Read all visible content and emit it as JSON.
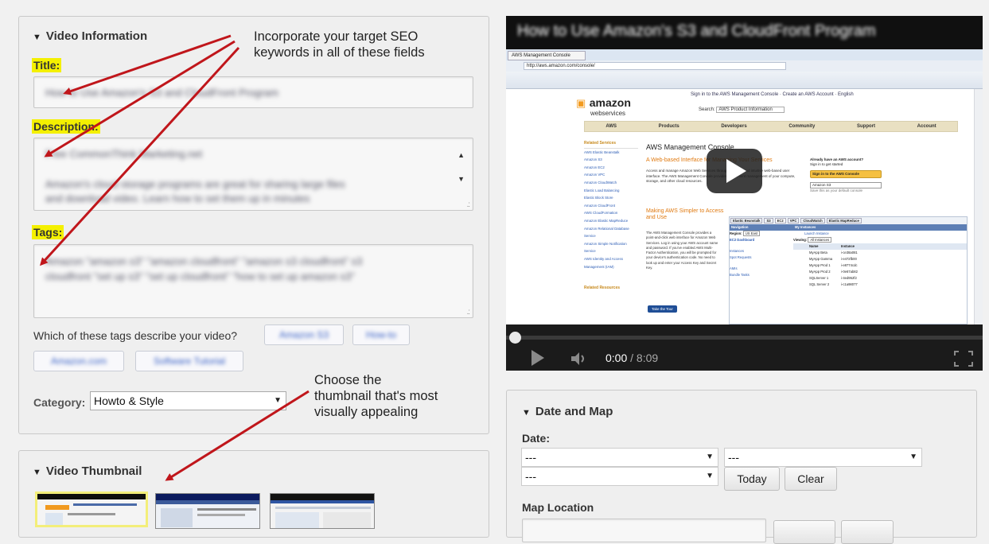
{
  "video_info": {
    "heading": "Video Information",
    "title_label": "Title:",
    "title_value": "How to Use Amazon's S3 and CloudFront Program",
    "description_label": "Description:",
    "description_line1": "Free CommonThink Marketing.net",
    "description_line2": "Amazon's cloud storage programs are great for sharing large files",
    "description_line3": "and download video. Learn how to set them up in minutes",
    "tags_label": "Tags:",
    "tags_line1": "Amazon \"amazon s3\" \"amazon cloudfront\" \"amazon s3 cloudfront\" s3",
    "tags_line2": "cloudfront \"set up s3\" \"set up cloudfront\" \"how to set up amazon s3\"",
    "suggest_question": "Which of these tags describe your video?",
    "suggested_tags": [
      "Amazon S3",
      "How-to",
      "Amazon.com",
      "Software Tutorial"
    ],
    "category_label": "Category:",
    "category_value": "Howto & Style"
  },
  "thumbnail": {
    "heading": "Video Thumbnail"
  },
  "annotations": {
    "seo_line1": "Incorporate your target SEO",
    "seo_line2": "keywords in all of these fields",
    "thumb_line1": "Choose the",
    "thumb_line2": "thumbnail that's most",
    "thumb_line3": "visually appealing"
  },
  "video": {
    "title": "How to Use Amazon's S3 and CloudFront Program",
    "time_current": "0:00",
    "time_total": " / 8:09",
    "progress": 0,
    "browser": {
      "tab": "AWS Management Console",
      "url": "http://aws.amazon.com/console/",
      "brand_line1": "amazon",
      "brand_line2": "webservices",
      "search_label": "Search:",
      "search_value": "AWS Product Information",
      "top_links": [
        "Sign in to the AWS Management Console",
        "Create an AWS Account",
        "English"
      ],
      "nav": [
        "AWS",
        "Products",
        "Developers",
        "Community",
        "Support",
        "Account"
      ],
      "side_heading": "Related Services",
      "side_items": [
        "AWS Elastic Beanstalk",
        "Amazon S3",
        "Amazon EC2",
        "Amazon VPC",
        "Amazon CloudWatch",
        "Elastic Load Balancing",
        "Elastic Block Store",
        "Amazon CloudFront",
        "AWS CloudFormation",
        "Amazon Elastic MapReduce",
        "Amazon Relational Database Service",
        "Amazon Simple Notification Service",
        "AWS Identity and Access Management (IAM)"
      ],
      "side_heading2": "Related Resources",
      "page_heading": "AWS Management Console",
      "subheading": "A Web-based Interface for Managing Your Services",
      "body_text": "Access and manage Amazon Web Services through a simple and intuitive web-based user interface. The AWS Management Console provides convenient management of your compute, storage, and other cloud resources.",
      "account_heading": "Already have an AWS account?",
      "account_sub": "Sign in to get started",
      "signin_button": "Sign in to the AWS Console",
      "select_value": "Amazon S3",
      "save_choice": "Save this as your default console",
      "h2": "Making AWS Simpler to Access and Use",
      "h2_body": "The AWS Management Console provides a point-and-click web interface for Amazon Web Services. Log in using your AWS account name and password. If you've enabled AWS Multi-Factor Authentication, you will be prompted for your device's authentication code. No need to look up and enter your Access Key and Secret Key.",
      "tour_button": "Take the Tour",
      "table_tabs": [
        "Elastic Beanstalk",
        "S3",
        "EC2",
        "VPC",
        "CloudWatch",
        "Elastic MapReduce"
      ],
      "nav_label": "Navigation",
      "region_label": "Region:",
      "region_value": "US East",
      "ec2_dashboard": "EC2 Dashboard",
      "instances_header": "My Instances",
      "launch": "Launch Instance",
      "viewing_label": "Viewing:",
      "viewing_value": "All Instances",
      "col_name": "Name",
      "col_instance": "Instance",
      "rows": [
        {
          "name": "MyApp Beta",
          "id": "i-ce38a081"
        },
        {
          "name": "MyApp Gamma",
          "id": "i-e472fb00"
        },
        {
          "name": "MyApp Prod 1",
          "id": "i-e8774cdc"
        },
        {
          "name": "MyApp Prod 2",
          "id": "i-0e67ab82"
        },
        {
          "name": "SQLServer 1",
          "id": "i-4ed952f2"
        },
        {
          "name": "SQL Server 2",
          "id": "i-c1a98077"
        }
      ],
      "left_nav": [
        "Instances",
        "Spot Requests",
        "AMIs",
        "Bundle Tasks"
      ]
    }
  },
  "date_map": {
    "heading": "Date and Map",
    "date_label": "Date:",
    "placeholder": "---",
    "today_button": "Today",
    "clear_button": "Clear",
    "map_label": "Map Location"
  }
}
